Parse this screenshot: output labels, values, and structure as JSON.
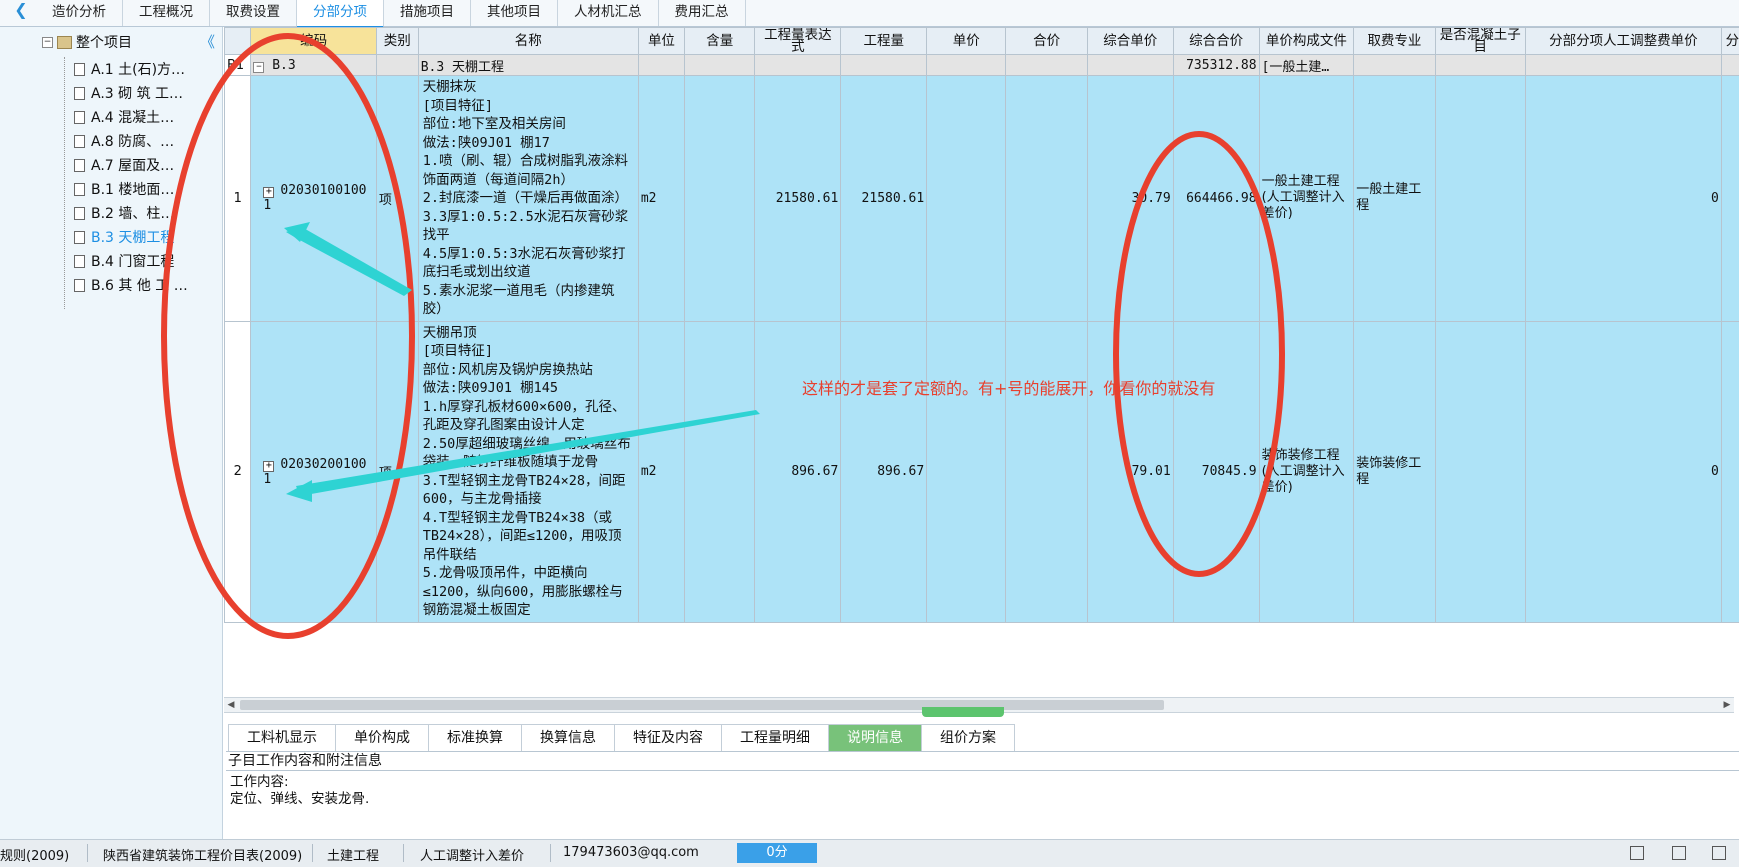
{
  "top_tabs": [
    "造价分析",
    "工程概况",
    "取费设置",
    "分部分项",
    "措施项目",
    "其他项目",
    "人材机汇总",
    "费用汇总"
  ],
  "active_top_tab": "分部分项",
  "tree": {
    "root": "整个项目",
    "items": [
      "A.1 土(石)方…",
      "A.3 砌 筑 工…",
      "A.4 混凝土…",
      "A.8 防腐、…",
      "A.7 屋面及…",
      "B.1 楼地面…",
      "B.2 墙、柱…",
      "B.3 天棚工程",
      "B.4 门窗工程",
      "B.6 其 他 工 …"
    ],
    "active_index": 7
  },
  "grid": {
    "headers": [
      "",
      "编码",
      "类别",
      "名称",
      "单位",
      "含量",
      "工程量表达式",
      "工程量",
      "单价",
      "合价",
      "综合单价",
      "综合合价",
      "单价构成文件",
      "取费专业",
      "是否混凝土子目",
      "分部分项人工调整费单价",
      "分"
    ],
    "group_row": {
      "idx": "B1",
      "toggle": "−",
      "code": "B.3",
      "name": "B.3   天棚工程",
      "total": "735312.88",
      "template": "[一般土建…"
    },
    "rows": [
      {
        "idx": "1",
        "code": "020301001001",
        "type": "项",
        "desc": "天棚抹灰\n[项目特征]\n部位:地下室及相关房间\n做法:陕09J01 棚17\n1.喷（刷、辊）合成树脂乳液涂料饰面两道（每道间隔2h）\n2.封底漆一道（干燥后再做面涂）\n3.3厚1:0.5:2.5水泥石灰膏砂浆找平\n4.5厚1:0.5:3水泥石灰膏砂浆打底扫毛或划出纹道\n5.素水泥浆一道甩毛（内掺建筑胶）",
        "unit": "m2",
        "expr": "21580.61",
        "qty": "21580.61",
        "unit_price": "30.79",
        "total": "664466.98",
        "template": "一般土建工程(人工调整计入差价)",
        "specialty": "一般土建工程",
        "labor_adj": "0"
      },
      {
        "idx": "2",
        "code": "020302001001",
        "type": "项",
        "desc": "天棚吊顶\n[项目特征]\n部位:风机房及锅炉房换热站\n做法:陕09J01 棚145\n1.h厚穿孔板材600×600，孔径、孔距及穿孔图案由设计人定\n2.50厚超细玻璃丝绵，用玻璃丝布袋装，随钉纤维板随填于龙骨\n3.T型轻钢主龙骨TB24×28，间距600，与主龙骨插接\n4.T型轻钢主龙骨TB24×38（或TB24×28），间距≤1200，用吸顶吊件联结\n5.龙骨吸顶吊件，中距横向≤1200，纵向600，用膨胀螺栓与钢筋混凝土板固定",
        "unit": "m2",
        "expr": "896.67",
        "qty": "896.67",
        "unit_price": "79.01",
        "total": "70845.9",
        "template": "装饰装修工程(人工调整计入差价)",
        "specialty": "装饰装修工程",
        "labor_adj": "0"
      }
    ]
  },
  "plus_sign": "+",
  "annotation": "这样的才是套了定额的。有+号的能展开，你看你的就没有",
  "bottom_tabs": [
    "工料机显示",
    "单价构成",
    "标准换算",
    "换算信息",
    "特征及内容",
    "工程量明细",
    "说明信息",
    "组价方案"
  ],
  "active_bottom_tab": "说明信息",
  "panel_title": "子目工作内容和附注信息",
  "panel_body": "工作内容:\n定位、弹线、安装龙骨.",
  "status": {
    "rule": "规则(2009)",
    "catalog": "陕西省建筑装饰工程价目表(2009)",
    "specialty": "土建工程",
    "labor": "人工调整计入差价",
    "account": "179473603@qq.com",
    "score": "0分"
  },
  "colors": {
    "accent": "#1d8fe3",
    "row_highlight": "#aee3f7",
    "annotation": "#e8402e",
    "arrow": "#2ed3d3",
    "active_bottom_tab": "#78c27a"
  }
}
